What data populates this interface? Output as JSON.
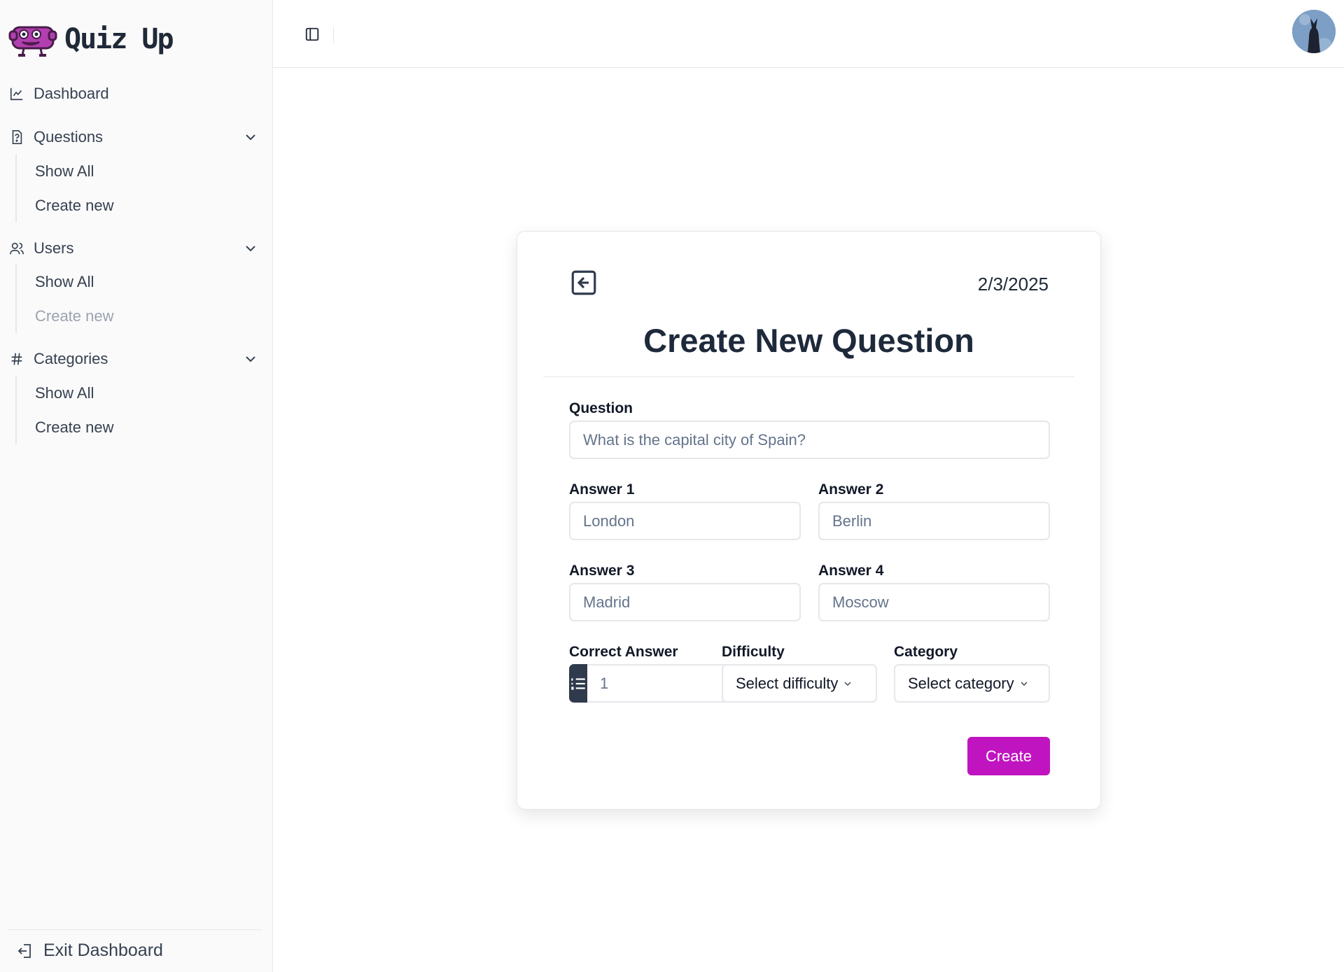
{
  "brand": {
    "name": "Quiz Up",
    "logo_icon": "monster-mascot-logo"
  },
  "sidebar": {
    "nav": [
      {
        "label": "Dashboard",
        "icon": "chart-line-icon"
      },
      {
        "label": "Questions",
        "icon": "file-question-icon",
        "children": [
          "Show All",
          "Create new"
        ]
      },
      {
        "label": "Users",
        "icon": "users-icon",
        "children": [
          "Show All",
          "Create new"
        ]
      },
      {
        "label": "Categories",
        "icon": "hash-icon",
        "children": [
          "Show All",
          "Create new"
        ]
      }
    ],
    "footer_label": "Exit Dashboard"
  },
  "header": {
    "toggle_icon": "sidebar-toggle-icon",
    "avatar_icon": "user-avatar"
  },
  "form": {
    "date": "2/3/2025",
    "title": "Create New Question",
    "question_label": "Question",
    "question_placeholder": "What is the capital city of Spain?",
    "answers": [
      {
        "label": "Answer 1",
        "placeholder": "London"
      },
      {
        "label": "Answer 2",
        "placeholder": "Berlin"
      },
      {
        "label": "Answer 3",
        "placeholder": "Madrid"
      },
      {
        "label": "Answer 4",
        "placeholder": "Moscow"
      }
    ],
    "correct_label": "Correct Answer",
    "correct_placeholder": "1",
    "difficulty_label": "Difficulty",
    "difficulty_value": "Select difficulty",
    "category_label": "Category",
    "category_value": "Select category",
    "submit_label": "Create"
  },
  "colors": {
    "accent": "#c014c0",
    "dark": "#2f3a4d",
    "border": "#e5e7eb"
  }
}
